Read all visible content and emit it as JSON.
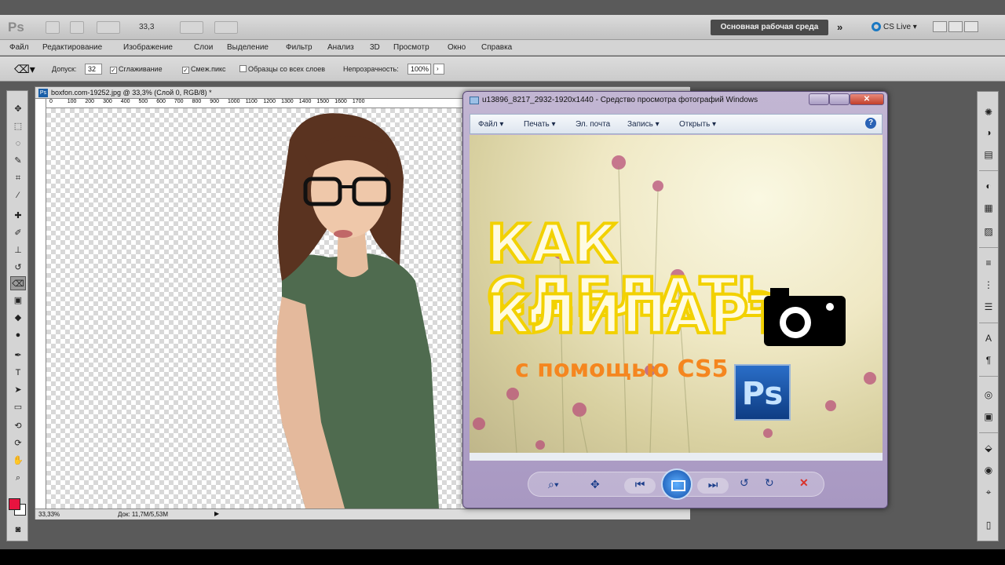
{
  "app": {
    "logo": "Ps",
    "zoom_value": "33,3",
    "workspace_label": "Основная рабочая среда",
    "cslive_label": "CS Live"
  },
  "menu": [
    "Файл",
    "Редактирование",
    "Изображение",
    "Слои",
    "Выделение",
    "Фильтр",
    "Анализ",
    "3D",
    "Просмотр",
    "Окно",
    "Справка"
  ],
  "options": {
    "tolerance_label": "Допуск:",
    "tolerance_value": "32",
    "antialias_label": "Сглаживание",
    "contiguous_label": "Смеж.пикс",
    "all_layers_label": "Образцы со всех слоев",
    "opacity_label": "Непрозрачность:",
    "opacity_value": "100%"
  },
  "document": {
    "tab_title": "boxfon.com-19252.jpg @ 33,3% (Слой 0, RGB/8) *",
    "ruler_marks": [
      "0",
      "100",
      "200",
      "300",
      "400",
      "500",
      "600",
      "700",
      "800",
      "900",
      "1000",
      "1100",
      "1200",
      "1300",
      "1400",
      "1500",
      "1600",
      "1700"
    ],
    "status_zoom": "33,33%",
    "status_doc": "Док: 11,7M/5,53M"
  },
  "viewer": {
    "title": "u13896_8217_2932-1920x1440 - Средство просмотра фотографий Windows",
    "menu": [
      "Файл",
      "Печать",
      "Эл. почта",
      "Запись",
      "Открыть"
    ],
    "image_text_line1": "КАК СДЕЛАТЬ",
    "image_text_line2": "КЛИПАРТ",
    "image_text_line3": "с помощью CS5",
    "badge_text": "Ps"
  },
  "colors": {
    "foreground": "#e8133f",
    "background": "#ffffff",
    "title_yellow": "#f2d100",
    "subtitle_orange": "#f5861f"
  }
}
